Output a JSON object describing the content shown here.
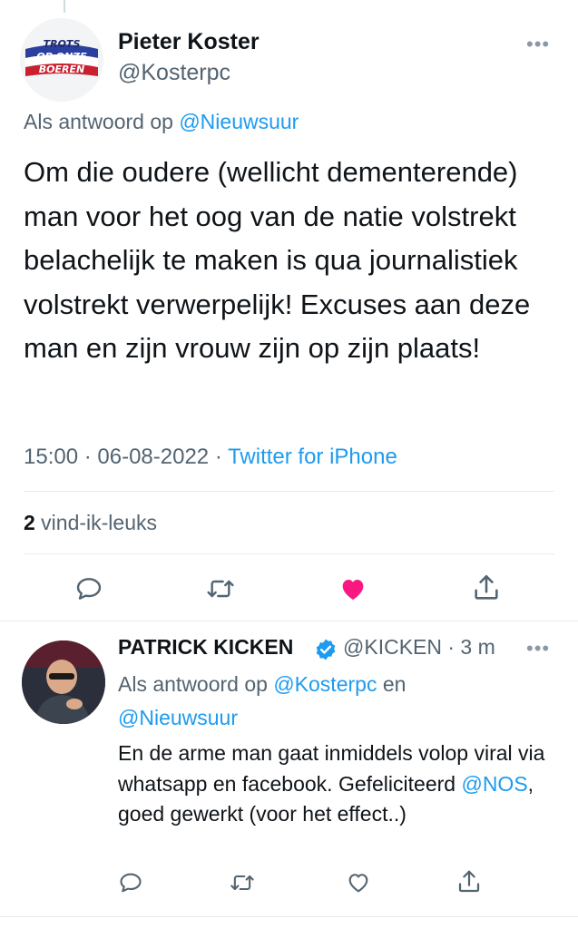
{
  "main_tweet": {
    "author_name": "Pieter Koster",
    "author_handle": "@Kosterpc",
    "avatar_text": [
      "TROTS",
      "OP ONZE",
      "BOEREN"
    ],
    "reply_prefix": "Als antwoord op ",
    "reply_mention": "@Nieuwsuur",
    "text": "Om die oudere (wellicht dementerende) man voor het oog van de natie volstrekt belachelijk te maken is qua journalistiek volstrekt verwerpelijk! Excuses aan deze man en zijn vrouw zijn op zijn plaats!",
    "time": "15:00",
    "separator": " · ",
    "date": "06-08-2022",
    "source": "Twitter for iPhone",
    "like_count": "2",
    "like_label": " vind-ik-leuks",
    "more_icon": "more-horizontal-icon"
  },
  "reply_tweet": {
    "author_name": "PATRICK KICKEN",
    "author_handle": "@KICKEN",
    "time_ago": " · 3 m",
    "reply_prefix": "Als antwoord op ",
    "reply_mention_1": "@Kosterpc",
    "reply_join": " en",
    "reply_mention_2": "@Nieuwsuur",
    "text_part1": "En de arme man gaat inmiddels volop viral via whatsapp en facebook. Gefeliciteerd ",
    "text_mention": "@NOS",
    "text_part2": ", goed gewerkt (voor het effect..)"
  },
  "colors": {
    "accent": "#1d9bf0",
    "like_active": "#f91880",
    "secondary_text": "#536471",
    "primary_text": "#0f1419"
  }
}
